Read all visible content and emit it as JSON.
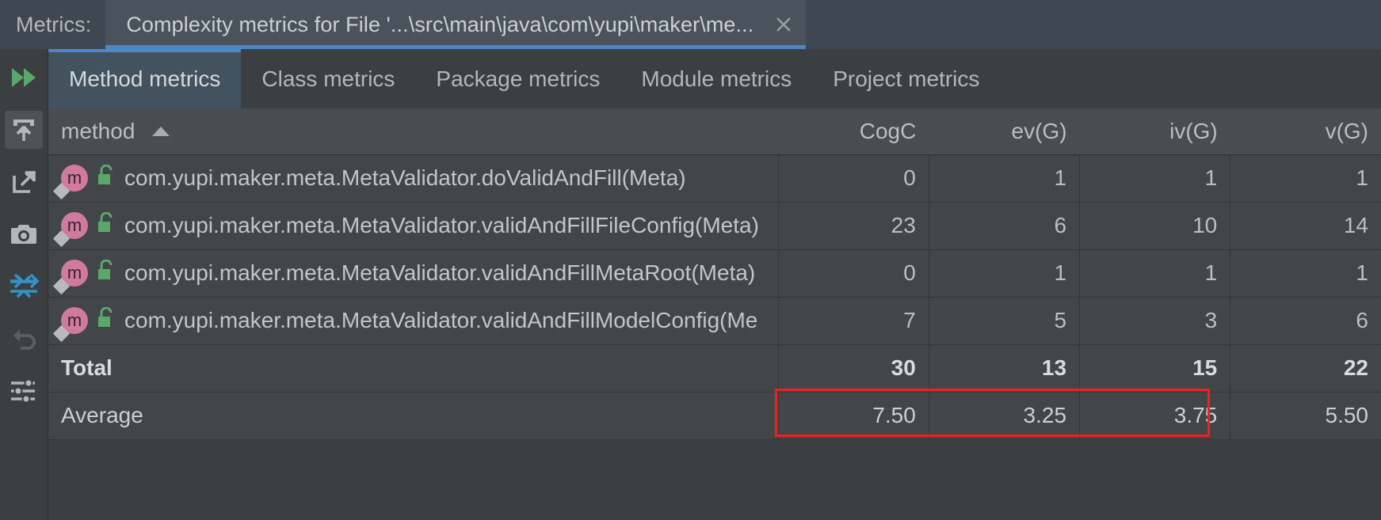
{
  "window": {
    "panel_label": "Metrics:",
    "tab_title": "Complexity metrics for File '...\\src\\main\\java\\com\\yupi\\maker\\me...",
    "close_icon": "close-icon"
  },
  "toolstrip": {
    "items": [
      {
        "name": "run-all-icon",
        "title": "Run"
      },
      {
        "name": "export-icon",
        "title": "Export"
      },
      {
        "name": "open-external-icon",
        "title": "Open in new window"
      },
      {
        "name": "snapshot-camera-icon",
        "title": "Snapshot"
      },
      {
        "name": "collapse-diff-icon",
        "title": "Compare snapshot"
      },
      {
        "name": "undo-icon",
        "title": "Revert"
      },
      {
        "name": "filter-settings-icon",
        "title": "Settings"
      }
    ]
  },
  "tabs": [
    {
      "label": "Method metrics",
      "selected": true
    },
    {
      "label": "Class metrics",
      "selected": false
    },
    {
      "label": "Package metrics",
      "selected": false
    },
    {
      "label": "Module metrics",
      "selected": false
    },
    {
      "label": "Project metrics",
      "selected": false
    }
  ],
  "table": {
    "columns": [
      {
        "key": "method",
        "label": "method",
        "align": "left",
        "sorted": "asc"
      },
      {
        "key": "cogc",
        "label": "CogC",
        "align": "right"
      },
      {
        "key": "evg",
        "label": "ev(G)",
        "align": "right"
      },
      {
        "key": "ivg",
        "label": "iv(G)",
        "align": "right"
      },
      {
        "key": "vg",
        "label": "v(G)",
        "align": "right"
      }
    ],
    "rows": [
      {
        "method": "com.yupi.maker.meta.MetaValidator.doValidAndFill(Meta)",
        "cogc": "0",
        "cogc_hot": false,
        "evg": "1",
        "evg_hot": false,
        "ivg": "1",
        "ivg_hot": false,
        "vg": "1",
        "vg_hot": false
      },
      {
        "method": "com.yupi.maker.meta.MetaValidator.validAndFillFileConfig(Meta)",
        "cogc": "23",
        "cogc_hot": true,
        "evg": "6",
        "evg_hot": true,
        "ivg": "10",
        "ivg_hot": true,
        "vg": "14",
        "vg_hot": true
      },
      {
        "method": "com.yupi.maker.meta.MetaValidator.validAndFillMetaRoot(Meta)",
        "cogc": "0",
        "cogc_hot": false,
        "evg": "1",
        "evg_hot": false,
        "ivg": "1",
        "ivg_hot": false,
        "vg": "1",
        "vg_hot": false
      },
      {
        "method": "com.yupi.maker.meta.MetaValidator.validAndFillModelConfig(Me",
        "cogc": "7",
        "cogc_hot": false,
        "evg": "5",
        "evg_hot": true,
        "ivg": "3",
        "ivg_hot": false,
        "vg": "6",
        "vg_hot": false
      }
    ],
    "total": {
      "label": "Total",
      "cogc": "30",
      "evg": "13",
      "ivg": "15",
      "vg": "22"
    },
    "average": {
      "label": "Average",
      "cogc": "7.50",
      "evg": "3.25",
      "ivg": "3.75",
      "vg": "5.50"
    }
  },
  "highlight": {
    "name": "average-values-highlight",
    "color": "#f02020"
  },
  "colors": {
    "accent_blue": "#4a88c7",
    "warning_red": "#f05a5a",
    "highlight_red": "#f02020",
    "panel_bg": "#3c3f41",
    "titlebar_bg": "#3f4750",
    "selected_tab_bg": "#42525f"
  }
}
